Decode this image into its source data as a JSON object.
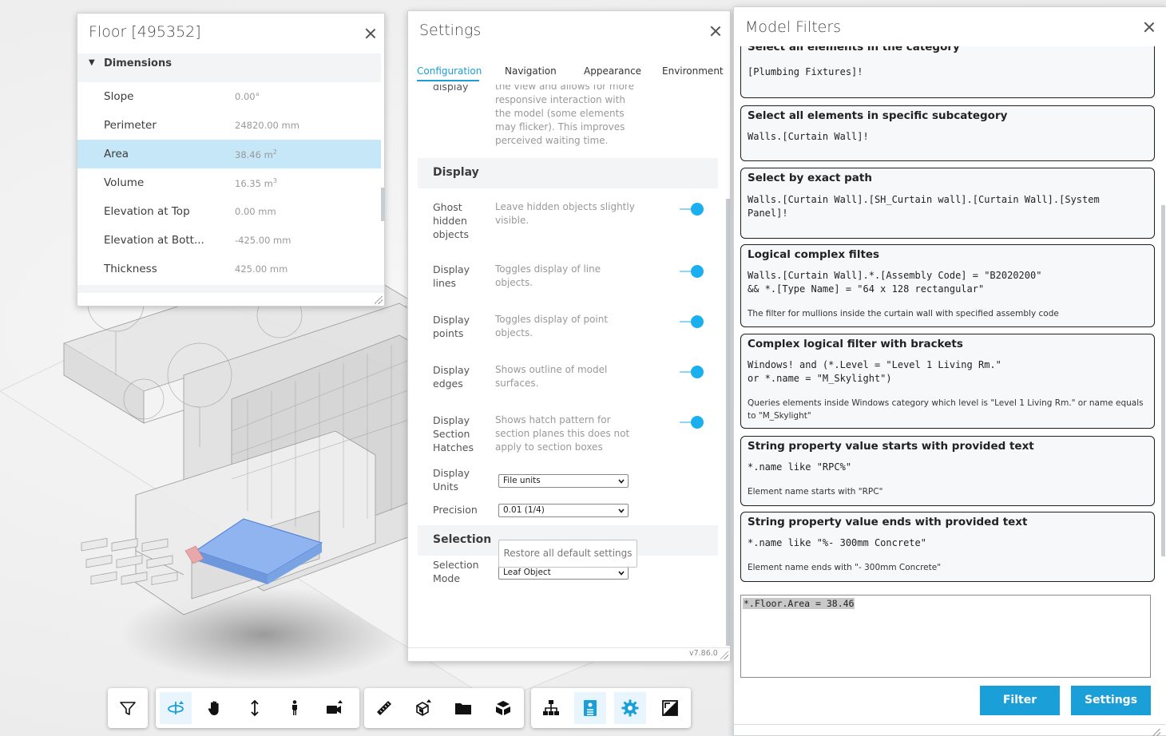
{
  "properties_panel": {
    "title": "Floor [495352]",
    "section": "Dimensions",
    "rows": [
      {
        "key": "Slope",
        "value": "0.00°",
        "sup": ""
      },
      {
        "key": "Perimeter",
        "value": "24820.00 mm",
        "sup": ""
      },
      {
        "key": "Area",
        "value": "38.46 m",
        "sup": "2"
      },
      {
        "key": "Volume",
        "value": "16.35 m",
        "sup": "3"
      },
      {
        "key": "Elevation at Top",
        "value": "0.00 mm",
        "sup": ""
      },
      {
        "key": "Elevation at Bott...",
        "value": "-425.00 mm",
        "sup": ""
      },
      {
        "key": "Thickness",
        "value": "425.00 mm",
        "sup": ""
      }
    ]
  },
  "settings_panel": {
    "title": "Settings",
    "tabs": [
      "Configuration",
      "Navigation",
      "Appearance",
      "Environment"
    ],
    "active_tab": "Configuration",
    "partial_label": "display",
    "partial_desc": "the view and allows for more responsive interaction with the model (some elements may flicker). This improves perceived waiting time.",
    "display_heading": "Display",
    "toggles": [
      {
        "label": "Ghost hidden objects",
        "desc": "Leave hidden objects slightly visible.",
        "on": true
      },
      {
        "label": "Display lines",
        "desc": "Toggles display of line objects.",
        "on": true
      },
      {
        "label": "Display points",
        "desc": "Toggles display of point objects.",
        "on": true
      },
      {
        "label": "Display edges",
        "desc": "Shows outline of model surfaces.",
        "on": true
      },
      {
        "label": "Display Section Hatches",
        "desc": "Shows hatch pattern for section planes this does not apply to section boxes",
        "on": true
      }
    ],
    "units_label": "Display Units",
    "units_value": "File units",
    "precision_label": "Precision",
    "precision_value": "0.01 (1/4)",
    "selection_heading": "Selection",
    "selection_mode_label": "Selection Mode",
    "selection_mode_value": "Leaf Object",
    "restore_label": "Restore all default settings",
    "version": "v7.86.0"
  },
  "filters_panel": {
    "title": "Model Filters",
    "cards": [
      {
        "title": "Select all elements in the category",
        "query": "[Plumbing Fixtures]!",
        "desc": ""
      },
      {
        "title": "Select all elements in specific subcategory",
        "query": "Walls.[Curtain Wall]!",
        "desc": ""
      },
      {
        "title": "Select by exact path",
        "query": "Walls.[Curtain Wall].[SH_Curtain wall].[Curtain Wall].[System\nPanel]!",
        "desc": ""
      },
      {
        "title": "Logical complex filtes",
        "query": "Walls.[Curtain Wall].*.[Assembly Code] = \"B2020200\"\n&& *.[Type Name] = \"64 x 128 rectangular\"",
        "desc": "The filter for mullions inside the curtain wall with specified assembly code"
      },
      {
        "title": "Complex logical filter with brackets",
        "query": "Windows! and (*.Level = \"Level 1 Living Rm.\"\nor *.name = \"M_Skylight\")",
        "desc": "Queries elements inside Windows category which level is \"Level 1 Living Rm.\" or name equals to \"M_Skylight\""
      },
      {
        "title": "String property value starts with provided text",
        "query": "*.name like \"RPC%\"",
        "desc": "Element name starts with \"RPC\""
      },
      {
        "title": "String property value ends with provided text",
        "query": "*.name like \"%- 300mm Concrete\"",
        "desc": "Element name ends with \"- 300mm Concrete\""
      }
    ],
    "query_text": "*.Floor.Area = 38.46",
    "filter_label": "Filter",
    "settings_label": "Settings"
  },
  "toolbar": {
    "groups": [
      [
        "filter-icon"
      ],
      [
        "orbit-icon",
        "pan-hand-icon",
        "zoom-icon",
        "first-person-icon",
        "camera-icon"
      ],
      [
        "measure-icon",
        "section-icon",
        "folder-icon",
        "explode-icon"
      ],
      [
        "model-browser-icon",
        "properties-icon",
        "settings-icon",
        "fullscreen-icon"
      ]
    ]
  },
  "colors": {
    "accent": "#1a9fd9",
    "toggle": "#1ab0f0",
    "selected_row": "#c5e7f7",
    "highlight_floor": "#8fb4f0"
  }
}
